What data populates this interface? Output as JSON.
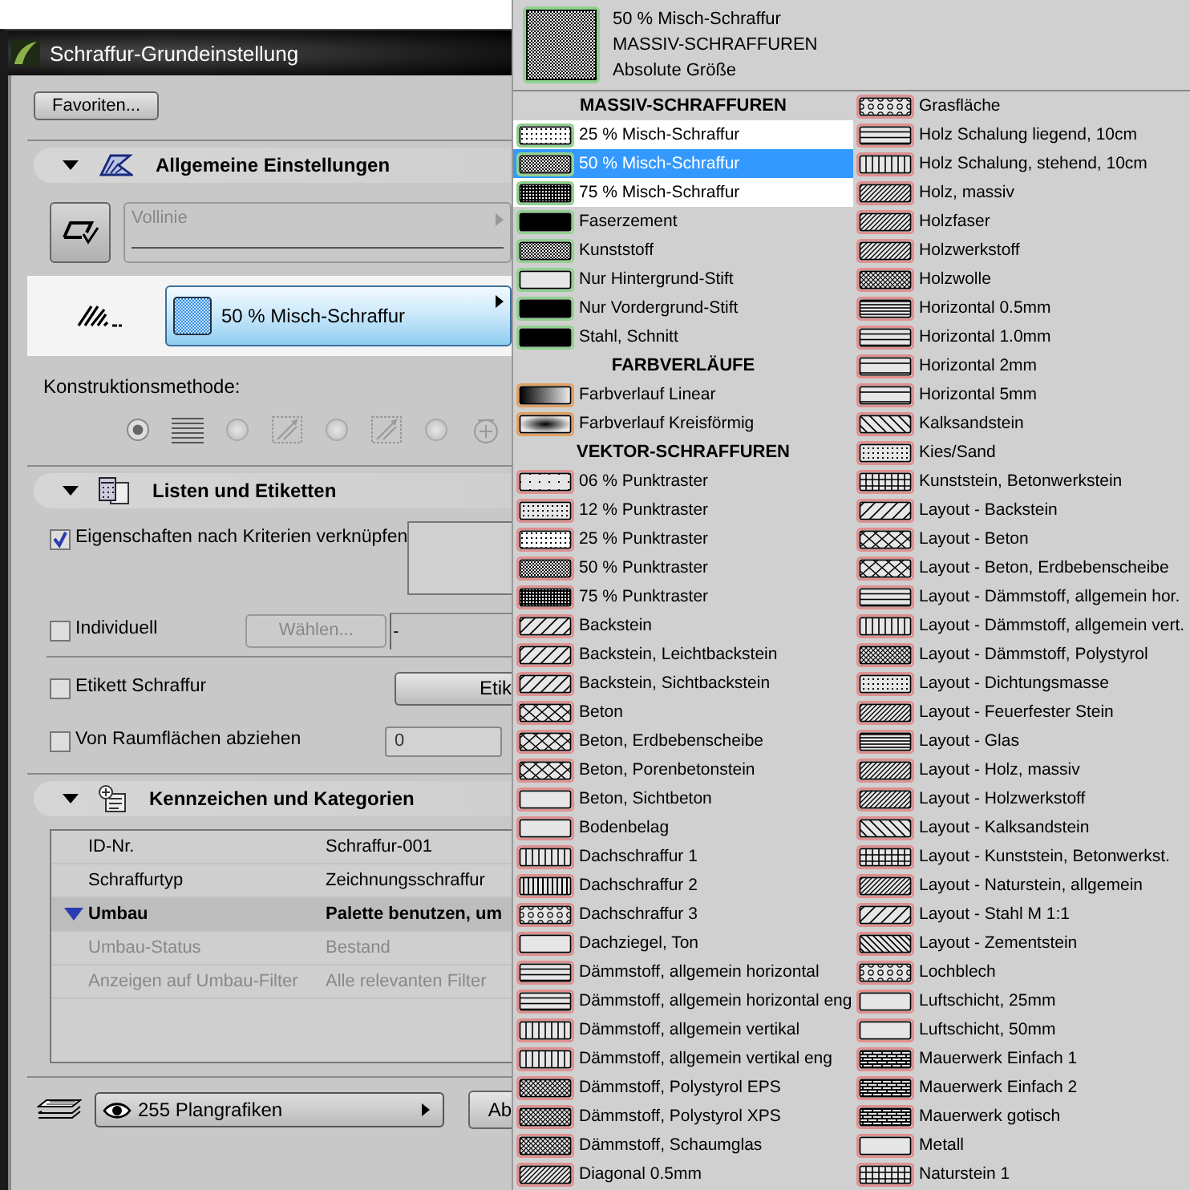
{
  "dialog": {
    "title": "Schraffur-Grundeinstellung",
    "favorites_button": "Favoriten...",
    "general": {
      "title": "Allgemeine Einstellungen",
      "expanded": true,
      "line_type": {
        "value": "Vollinie",
        "disabled": true
      },
      "fill_type": {
        "value": "50 % Misch-Schraffur"
      },
      "construction_label": "Konstruktionsmethode:",
      "construction_methods": [
        {
          "selected": true
        },
        {
          "selected": false
        },
        {
          "selected": false
        },
        {
          "selected": false
        }
      ]
    },
    "listing": {
      "title": "Listen und Etiketten",
      "expanded": true,
      "link_criteria": {
        "label": "Eigenschaften nach Kriterien verknüpfen",
        "checked": true
      },
      "individual": {
        "label": "Individuell",
        "checked": false
      },
      "choose_button": {
        "label": "Wählen...",
        "disabled": true
      },
      "individual_value": "-",
      "label_fill": {
        "label": "Etikett Schraffur",
        "checked": false
      },
      "label_button": "Etik",
      "subtract": {
        "label": "Von Raumflächen abziehen",
        "checked": false
      },
      "subtract_value": "0"
    },
    "ids": {
      "title": "Kennzeichen und Kategorien",
      "expanded": true,
      "rows": [
        {
          "kind": "field",
          "name": "ID-Nr.",
          "value": "Schraffur-001"
        },
        {
          "kind": "field",
          "name": "Schraffurtyp",
          "value": "Zeichnungsschraffur"
        },
        {
          "kind": "group",
          "name": "Umbau",
          "value": "Palette benutzen, um"
        },
        {
          "kind": "disabled",
          "name": "Umbau-Status",
          "value": "Bestand"
        },
        {
          "kind": "disabled",
          "name": "Anzeigen auf Umbau-Filter",
          "value": "Alle relevanten Filter"
        }
      ]
    },
    "layers": {
      "value": "255 Plangrafiken"
    },
    "cancel_button": "Ab"
  },
  "popup": {
    "preview": {
      "name": "50 % Misch-Schraffur",
      "category": "MASSIV-SCHRAFFUREN",
      "size": "Absolute Größe",
      "color": "#8fd18f"
    },
    "columns": [
      [
        {
          "kind": "header",
          "label": "MASSIV-SCHRAFFUREN"
        },
        {
          "kind": "item",
          "label": "25 % Misch-Schraffur",
          "color": "#8fd18f",
          "selected": false,
          "highlighted": true
        },
        {
          "kind": "item",
          "label": "50 % Misch-Schraffur",
          "color": "#8fd18f",
          "selected": true,
          "highlighted": true
        },
        {
          "kind": "item",
          "label": "75 % Misch-Schraffur",
          "color": "#8fd18f",
          "selected": false,
          "highlighted": true
        },
        {
          "kind": "item",
          "label": "Faserzement",
          "color": "#8fd18f",
          "selected": false,
          "highlighted": false
        },
        {
          "kind": "item",
          "label": "Kunststoff",
          "color": "#8fd18f",
          "selected": false,
          "highlighted": false
        },
        {
          "kind": "item",
          "label": "Nur Hintergrund-Stift",
          "color": "#8fd18f",
          "selected": false,
          "highlighted": false
        },
        {
          "kind": "item",
          "label": "Nur Vordergrund-Stift",
          "color": "#8fd18f",
          "selected": false,
          "highlighted": false
        },
        {
          "kind": "item",
          "label": "Stahl, Schnitt",
          "color": "#8fd18f",
          "selected": false,
          "highlighted": false
        },
        {
          "kind": "header",
          "label": "FARBVERLÄUFE"
        },
        {
          "kind": "item",
          "label": "Farbverlauf Linear",
          "color": "#e0a060",
          "selected": false,
          "highlighted": false
        },
        {
          "kind": "item",
          "label": "Farbverlauf Kreisförmig",
          "color": "#e0a060",
          "selected": false,
          "highlighted": false
        },
        {
          "kind": "header",
          "label": "VEKTOR-SCHRAFFUREN"
        },
        {
          "kind": "item",
          "label": "06 % Punktraster",
          "color": "#e09090",
          "selected": false,
          "highlighted": false
        },
        {
          "kind": "item",
          "label": "12 % Punktraster",
          "color": "#e09090",
          "selected": false,
          "highlighted": false
        },
        {
          "kind": "item",
          "label": "25 % Punktraster",
          "color": "#e09090",
          "selected": false,
          "highlighted": false
        },
        {
          "kind": "item",
          "label": "50 % Punktraster",
          "color": "#e09090",
          "selected": false,
          "highlighted": false
        },
        {
          "kind": "item",
          "label": "75 % Punktraster",
          "color": "#e09090",
          "selected": false,
          "highlighted": false
        },
        {
          "kind": "item",
          "label": "Backstein",
          "color": "#e09090",
          "selected": false,
          "highlighted": false
        },
        {
          "kind": "item",
          "label": "Backstein, Leichtbackstein",
          "color": "#e09090",
          "selected": false,
          "highlighted": false
        },
        {
          "kind": "item",
          "label": "Backstein, Sichtbackstein",
          "color": "#e09090",
          "selected": false,
          "highlighted": false
        },
        {
          "kind": "item",
          "label": "Beton",
          "color": "#e09090",
          "selected": false,
          "highlighted": false
        },
        {
          "kind": "item",
          "label": "Beton, Erdbebenscheibe",
          "color": "#e09090",
          "selected": false,
          "highlighted": false
        },
        {
          "kind": "item",
          "label": "Beton, Porenbetonstein",
          "color": "#e09090",
          "selected": false,
          "highlighted": false
        },
        {
          "kind": "item",
          "label": "Beton, Sichtbeton",
          "color": "#e09090",
          "selected": false,
          "highlighted": false
        },
        {
          "kind": "item",
          "label": "Bodenbelag",
          "color": "#e09090",
          "selected": false,
          "highlighted": false
        },
        {
          "kind": "item",
          "label": "Dachschraffur 1",
          "color": "#e09090",
          "selected": false,
          "highlighted": false
        },
        {
          "kind": "item",
          "label": "Dachschraffur 2",
          "color": "#e09090",
          "selected": false,
          "highlighted": false
        },
        {
          "kind": "item",
          "label": "Dachschraffur 3",
          "color": "#e09090",
          "selected": false,
          "highlighted": false
        },
        {
          "kind": "item",
          "label": "Dachziegel, Ton",
          "color": "#e09090",
          "selected": false,
          "highlighted": false
        },
        {
          "kind": "item",
          "label": "Dämmstoff, allgemein horizontal",
          "color": "#e09090",
          "selected": false,
          "highlighted": false
        },
        {
          "kind": "item",
          "label": "Dämmstoff, allgemein horizontal eng",
          "color": "#e09090",
          "selected": false,
          "highlighted": false
        },
        {
          "kind": "item",
          "label": "Dämmstoff, allgemein vertikal",
          "color": "#e09090",
          "selected": false,
          "highlighted": false
        },
        {
          "kind": "item",
          "label": "Dämmstoff, allgemein vertikal eng",
          "color": "#e09090",
          "selected": false,
          "highlighted": false
        },
        {
          "kind": "item",
          "label": "Dämmstoff, Polystyrol EPS",
          "color": "#e09090",
          "selected": false,
          "highlighted": false
        },
        {
          "kind": "item",
          "label": "Dämmstoff, Polystyrol XPS",
          "color": "#e09090",
          "selected": false,
          "highlighted": false
        },
        {
          "kind": "item",
          "label": "Dämmstoff, Schaumglas",
          "color": "#e09090",
          "selected": false,
          "highlighted": false
        },
        {
          "kind": "item",
          "label": "Diagonal 0.5mm",
          "color": "#e09090",
          "selected": false,
          "highlighted": false
        }
      ],
      [
        {
          "kind": "item",
          "label": "Grasfläche",
          "color": "#e09090",
          "selected": false,
          "highlighted": false
        },
        {
          "kind": "item",
          "label": "Holz Schalung liegend, 10cm",
          "color": "#e09090",
          "selected": false,
          "highlighted": false
        },
        {
          "kind": "item",
          "label": "Holz Schalung, stehend, 10cm",
          "color": "#e09090",
          "selected": false,
          "highlighted": false
        },
        {
          "kind": "item",
          "label": "Holz, massiv",
          "color": "#e09090",
          "selected": false,
          "highlighted": false
        },
        {
          "kind": "item",
          "label": "Holzfaser",
          "color": "#e09090",
          "selected": false,
          "highlighted": false
        },
        {
          "kind": "item",
          "label": "Holzwerkstoff",
          "color": "#e09090",
          "selected": false,
          "highlighted": false
        },
        {
          "kind": "item",
          "label": "Holzwolle",
          "color": "#e09090",
          "selected": false,
          "highlighted": false
        },
        {
          "kind": "item",
          "label": "Horizontal 0.5mm",
          "color": "#e09090",
          "selected": false,
          "highlighted": false
        },
        {
          "kind": "item",
          "label": "Horizontal 1.0mm",
          "color": "#e09090",
          "selected": false,
          "highlighted": false
        },
        {
          "kind": "item",
          "label": "Horizontal 2mm",
          "color": "#e09090",
          "selected": false,
          "highlighted": false
        },
        {
          "kind": "item",
          "label": "Horizontal 5mm",
          "color": "#e09090",
          "selected": false,
          "highlighted": false
        },
        {
          "kind": "item",
          "label": "Kalksandstein",
          "color": "#e09090",
          "selected": false,
          "highlighted": false
        },
        {
          "kind": "item",
          "label": "Kies/Sand",
          "color": "#e09090",
          "selected": false,
          "highlighted": false
        },
        {
          "kind": "item",
          "label": "Kunststein, Betonwerkstein",
          "color": "#e09090",
          "selected": false,
          "highlighted": false
        },
        {
          "kind": "item",
          "label": "Layout - Backstein",
          "color": "#e09090",
          "selected": false,
          "highlighted": false
        },
        {
          "kind": "item",
          "label": "Layout - Beton",
          "color": "#e09090",
          "selected": false,
          "highlighted": false
        },
        {
          "kind": "item",
          "label": "Layout - Beton, Erdbebenscheibe",
          "color": "#e09090",
          "selected": false,
          "highlighted": false
        },
        {
          "kind": "item",
          "label": "Layout - Dämmstoff, allgemein hor.",
          "color": "#e09090",
          "selected": false,
          "highlighted": false
        },
        {
          "kind": "item",
          "label": "Layout - Dämmstoff, allgemein vert.",
          "color": "#e09090",
          "selected": false,
          "highlighted": false
        },
        {
          "kind": "item",
          "label": "Layout - Dämmstoff, Polystyrol",
          "color": "#e09090",
          "selected": false,
          "highlighted": false
        },
        {
          "kind": "item",
          "label": "Layout - Dichtungsmasse",
          "color": "#e09090",
          "selected": false,
          "highlighted": false
        },
        {
          "kind": "item",
          "label": "Layout - Feuerfester Stein",
          "color": "#e09090",
          "selected": false,
          "highlighted": false
        },
        {
          "kind": "item",
          "label": "Layout - Glas",
          "color": "#e09090",
          "selected": false,
          "highlighted": false
        },
        {
          "kind": "item",
          "label": "Layout - Holz, massiv",
          "color": "#e09090",
          "selected": false,
          "highlighted": false
        },
        {
          "kind": "item",
          "label": "Layout - Holzwerkstoff",
          "color": "#e09090",
          "selected": false,
          "highlighted": false
        },
        {
          "kind": "item",
          "label": "Layout - Kalksandstein",
          "color": "#e09090",
          "selected": false,
          "highlighted": false
        },
        {
          "kind": "item",
          "label": "Layout - Kunststein, Betonwerkst.",
          "color": "#e09090",
          "selected": false,
          "highlighted": false
        },
        {
          "kind": "item",
          "label": "Layout - Naturstein, allgemein",
          "color": "#e09090",
          "selected": false,
          "highlighted": false
        },
        {
          "kind": "item",
          "label": "Layout - Stahl M 1:1",
          "color": "#e09090",
          "selected": false,
          "highlighted": false
        },
        {
          "kind": "item",
          "label": "Layout - Zementstein",
          "color": "#e09090",
          "selected": false,
          "highlighted": false
        },
        {
          "kind": "item",
          "label": "Lochblech",
          "color": "#e09090",
          "selected": false,
          "highlighted": false
        },
        {
          "kind": "item",
          "label": "Luftschicht, 25mm",
          "color": "#e09090",
          "selected": false,
          "highlighted": false
        },
        {
          "kind": "item",
          "label": "Luftschicht, 50mm",
          "color": "#e09090",
          "selected": false,
          "highlighted": false
        },
        {
          "kind": "item",
          "label": "Mauerwerk Einfach 1",
          "color": "#e09090",
          "selected": false,
          "highlighted": false
        },
        {
          "kind": "item",
          "label": "Mauerwerk Einfach 2",
          "color": "#e09090",
          "selected": false,
          "highlighted": false
        },
        {
          "kind": "item",
          "label": "Mauerwerk gotisch",
          "color": "#e09090",
          "selected": false,
          "highlighted": false
        },
        {
          "kind": "item",
          "label": "Metall",
          "color": "#e09090",
          "selected": false,
          "highlighted": false
        },
        {
          "kind": "item",
          "label": "Naturstein 1",
          "color": "#e09090",
          "selected": false,
          "highlighted": false
        }
      ]
    ]
  }
}
